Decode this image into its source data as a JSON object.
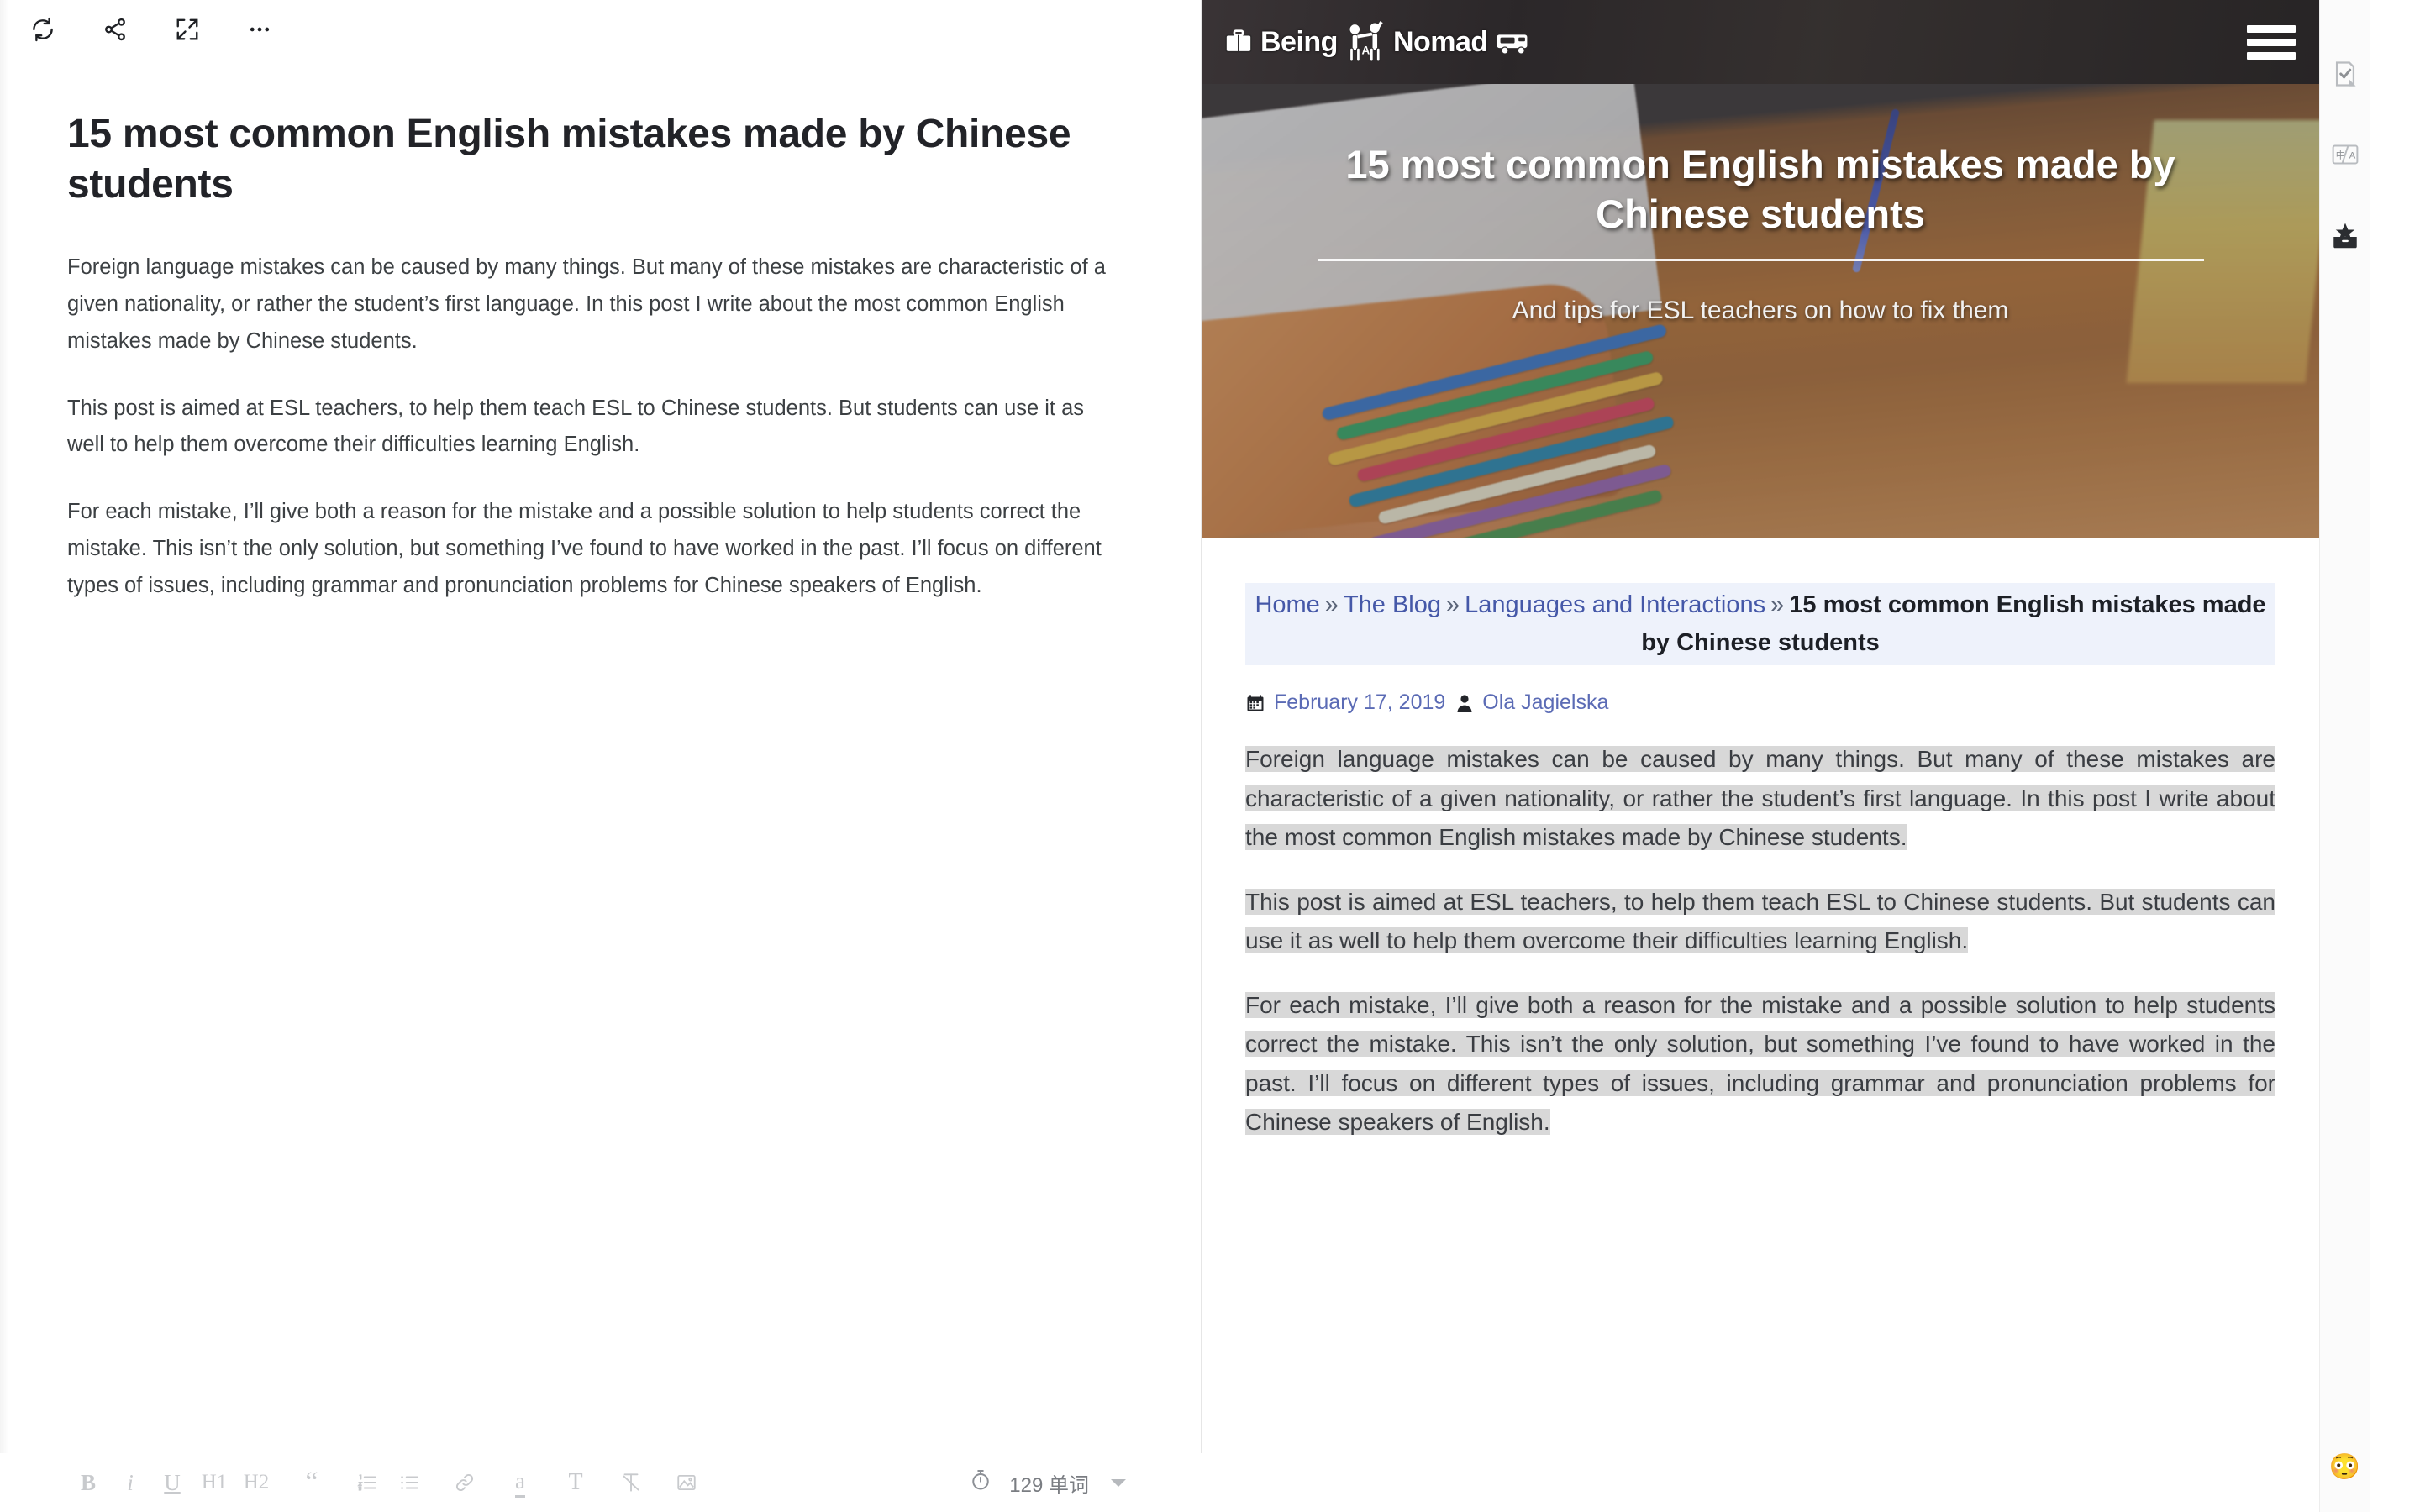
{
  "editor": {
    "toolbar": {
      "items": [
        {
          "name": "refresh-icon",
          "label": "Refresh"
        },
        {
          "name": "share-icon",
          "label": "Share"
        },
        {
          "name": "fullscreen-icon",
          "label": "Fullscreen"
        },
        {
          "name": "more-options-icon",
          "label": "More"
        }
      ]
    },
    "document": {
      "title": "15 most common English mistakes made by Chinese students",
      "paragraphs": [
        "Foreign language mistakes can be caused by many things. But many of these mistakes are characteristic of a given nationality, or rather the student’s first language. In this post I write about the most common English mistakes made by Chinese students.",
        "This post is aimed at ESL teachers, to help them teach ESL to Chinese students. But students can use it as well to help them overcome their difficulties learning English.",
        "For each mistake, I’ll give both a reason for the mistake and a possible solution to help students correct the mistake. This isn’t the only solution, but something I’ve found to have worked in the past. I’ll focus on different types of issues, including grammar and pronunciation problems for Chinese speakers of English."
      ]
    },
    "format_toolbar": {
      "buttons": [
        {
          "name": "bold-button",
          "label": "B"
        },
        {
          "name": "italic-button",
          "label": "i"
        },
        {
          "name": "underline-button",
          "label": "U"
        },
        {
          "name": "heading-1-button",
          "label": "H1"
        },
        {
          "name": "heading-2-button",
          "label": "H2"
        },
        {
          "name": "blockquote-button",
          "label": "“"
        },
        {
          "name": "ordered-list-button",
          "label": "ordered-list-icon"
        },
        {
          "name": "bullet-list-button",
          "label": "bullet-list-icon"
        },
        {
          "name": "link-button",
          "label": "link-icon"
        },
        {
          "name": "highlight-button",
          "label": "a"
        },
        {
          "name": "text-style-button",
          "label": "T"
        },
        {
          "name": "clear-format-button",
          "label": "clear-format-icon"
        },
        {
          "name": "insert-image-button",
          "label": "image-icon"
        }
      ]
    },
    "status": {
      "word_count": "129 单词",
      "timer_icon": "timer-icon"
    }
  },
  "preview": {
    "site": {
      "logo_text_1": "Being",
      "logo_text_2": "Nomad",
      "menu_icon": "hamburger-menu-icon"
    },
    "hero": {
      "title": "15 most common English mistakes made by Chinese students",
      "subtitle": "And tips for ESL teachers on how to fix them"
    },
    "breadcrumb": {
      "items": [
        {
          "label": "Home",
          "link": true
        },
        {
          "label": "The Blog",
          "link": true
        },
        {
          "label": "Languages and Interactions",
          "link": true
        }
      ],
      "separator": "»",
      "current": "15 most common English mistakes made by Chinese students"
    },
    "meta": {
      "date": "February 17, 2019",
      "author": "Ola Jagielska",
      "date_icon": "calendar-icon",
      "author_icon": "user-icon"
    },
    "paragraphs": [
      "Foreign language mistakes can be caused by many things. But many of these mistakes are characteristic of a given nationality, or rather the student’s first language. In this post I write about the most common English mistakes made by Chinese students.",
      "This post is aimed at ESL teachers, to help them teach ESL to Chinese students. But students can use it as well to help them overcome their difficulties learning English.",
      "For each mistake, I’ll give both a reason for the mistake and a possible solution to help students correct the mistake. This isn’t the only solution, but something I’ve found to have worked in the past. I’ll focus on different types of issues, including grammar and pronunciation problems for Chinese speakers of English."
    ]
  },
  "rail": {
    "buttons": [
      {
        "name": "document-check-icon",
        "label": "Proofread"
      },
      {
        "name": "translate-icon",
        "label": "Translate"
      },
      {
        "name": "archive-star-icon",
        "label": "Collection"
      }
    ],
    "emoji": "😳"
  },
  "colors": {
    "header_bg": "#2e2b2c",
    "breadcrumb_bg": "#eef2fb",
    "link": "#4558a8",
    "highlight": "#d8d8d8",
    "editor_text": "#3c4043"
  }
}
